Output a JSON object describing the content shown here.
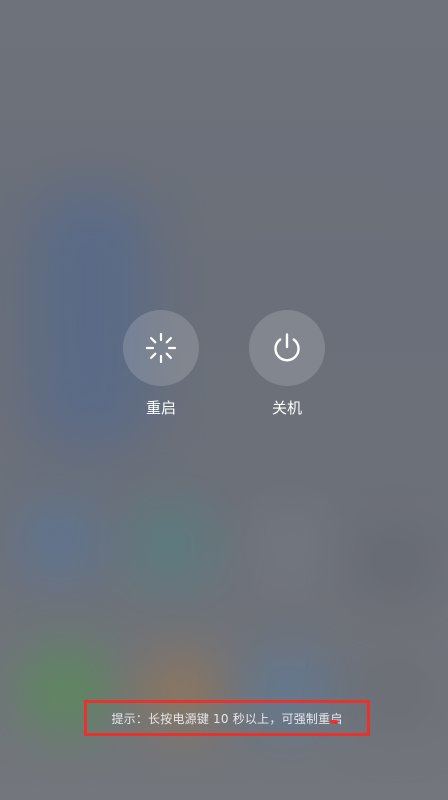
{
  "power_menu": {
    "options": [
      {
        "label": "重启",
        "icon": "restart-spinner-icon"
      },
      {
        "label": "关机",
        "icon": "power-icon"
      }
    ],
    "hint": "提示：长按电源键 10 秒以上，可强制重启"
  },
  "colors": {
    "annotation_red": "#e8322e",
    "button_circle": "rgba(255,255,255,0.16)",
    "text": "#ffffff"
  }
}
